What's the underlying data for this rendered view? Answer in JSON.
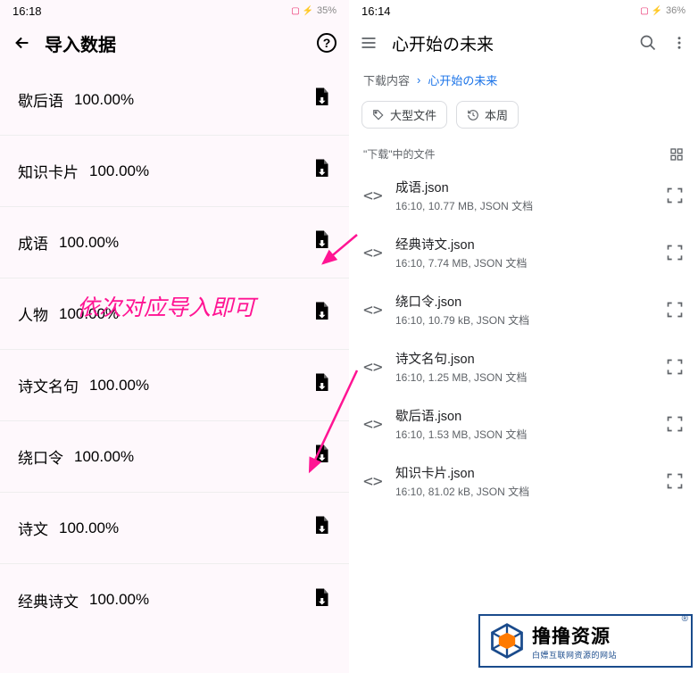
{
  "left": {
    "status_time": "16:18",
    "status_battery": "35%",
    "header_title": "导入数据",
    "items": [
      {
        "label": "歇后语",
        "pct": "100.00%"
      },
      {
        "label": "知识卡片",
        "pct": "100.00%"
      },
      {
        "label": "成语",
        "pct": "100.00%"
      },
      {
        "label": "人物",
        "pct": "100.00%"
      },
      {
        "label": "诗文名句",
        "pct": "100.00%"
      },
      {
        "label": "绕口令",
        "pct": "100.00%"
      },
      {
        "label": "诗文",
        "pct": "100.00%"
      },
      {
        "label": "经典诗文",
        "pct": "100.00%"
      }
    ],
    "annotation": "依次对应导入即可"
  },
  "right": {
    "status_time": "16:14",
    "status_battery": "36%",
    "header_title": "心开始の未来",
    "breadcrumb_root": "下载内容",
    "breadcrumb_current": "心开始の未来",
    "chip1": "大型文件",
    "chip2": "本周",
    "section_label": "\"下载\"中的文件",
    "files": [
      {
        "name": "成语.json",
        "meta": "16:10, 10.77 MB, JSON 文档"
      },
      {
        "name": "经典诗文.json",
        "meta": "16:10, 7.74 MB, JSON 文档"
      },
      {
        "name": "绕口令.json",
        "meta": "16:10, 10.79 kB, JSON 文档"
      },
      {
        "name": "诗文名句.json",
        "meta": "16:10, 1.25 MB, JSON 文档"
      },
      {
        "name": "歇后语.json",
        "meta": "16:10, 1.53 MB, JSON 文档"
      },
      {
        "name": "知识卡片.json",
        "meta": "16:10, 81.02 kB, JSON 文档"
      }
    ]
  },
  "logo": {
    "main": "撸撸资源",
    "sub": "白嫖互联网资源的网站"
  }
}
